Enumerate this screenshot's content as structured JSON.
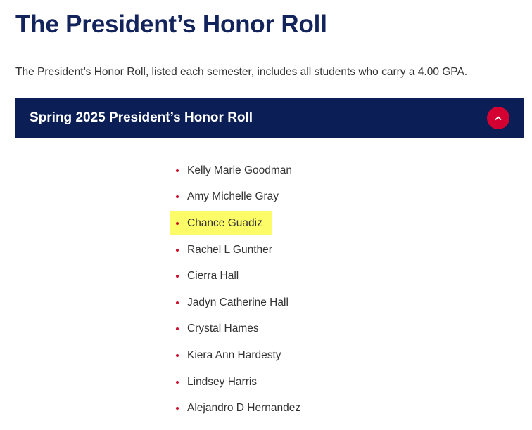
{
  "page": {
    "title": "The President’s Honor Roll",
    "intro": "The President’s Honor Roll, listed each semester, includes all students who carry a 4.00 GPA."
  },
  "accordion": {
    "title": "Spring 2025 President’s Honor Roll",
    "expanded": true,
    "toggle_icon": "chevron-up-icon",
    "header_color": "#0b1f56",
    "toggle_color": "#d50032"
  },
  "names": [
    "Kelly Marie Goodman",
    "Amy Michelle Gray",
    "Chance Guadiz",
    "Rachel L Gunther",
    "Cierra Hall",
    "Jadyn Catherine Hall",
    "Crystal Hames",
    "Kiera Ann Hardesty",
    "Lindsey Harris",
    "Alejandro D Hernandez"
  ],
  "highlight": {
    "name": "Chance Guadiz",
    "color": "#fbfc68"
  },
  "colors": {
    "title": "#13235b",
    "bullet": "#c8102e"
  }
}
